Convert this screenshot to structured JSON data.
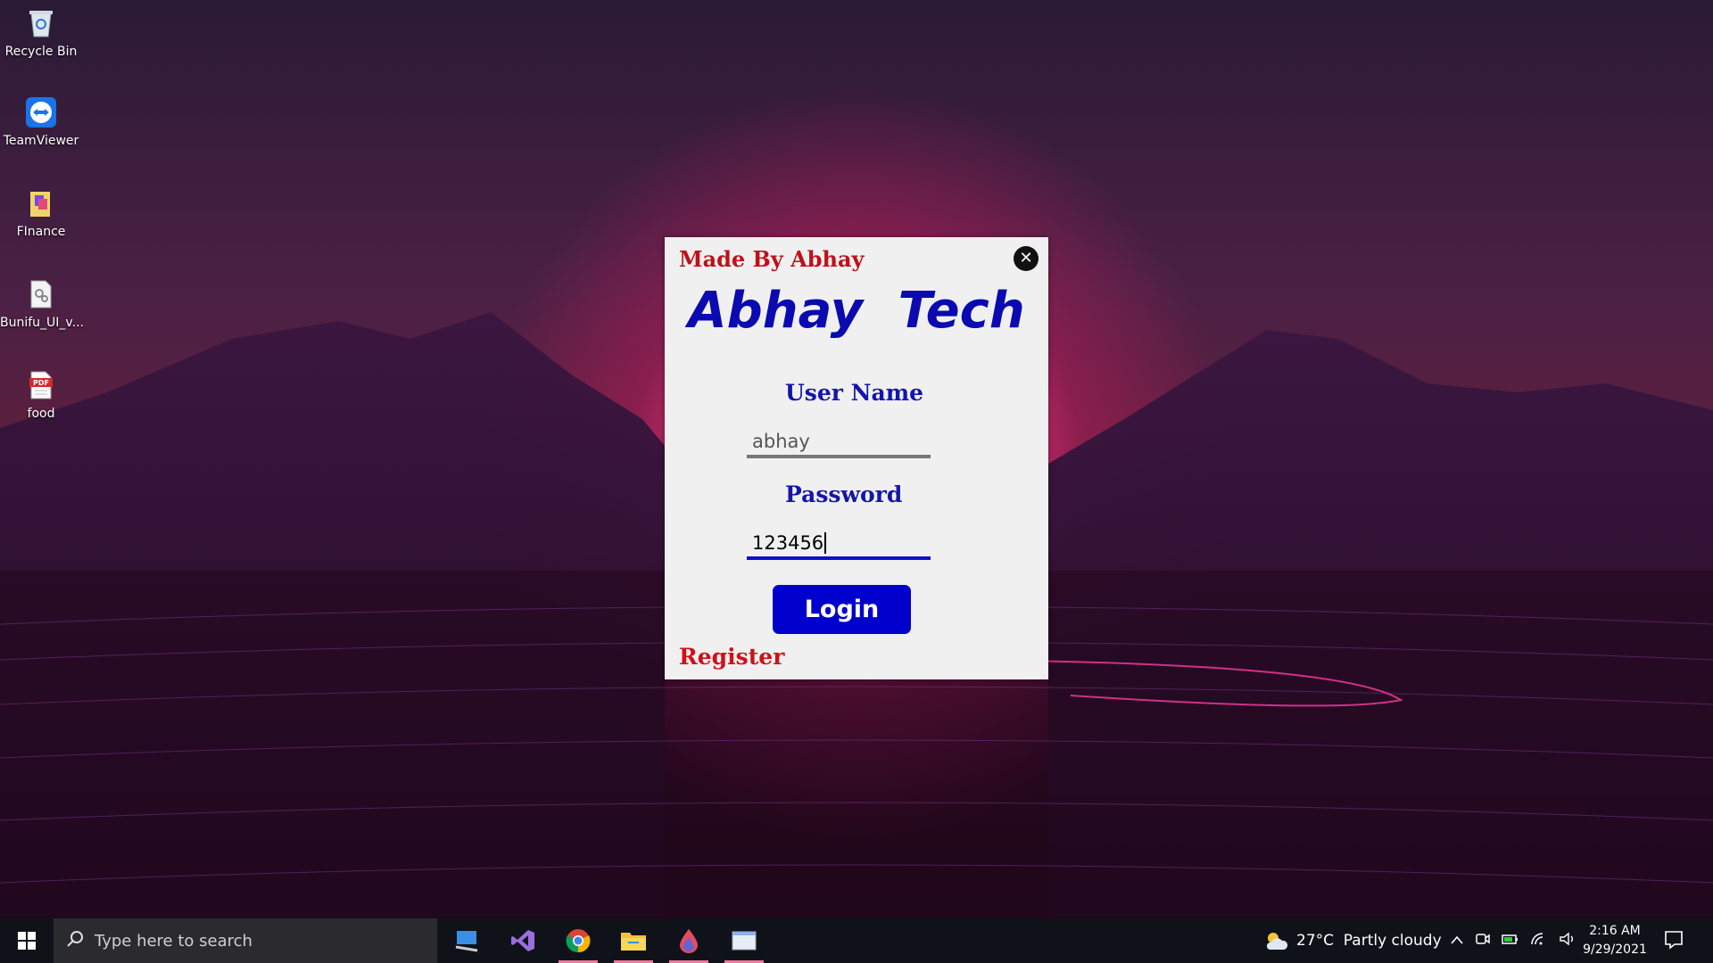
{
  "desktop": {
    "icons": [
      {
        "name": "recycle-bin",
        "label": "Recycle Bin"
      },
      {
        "name": "teamviewer",
        "label": "TeamViewer"
      },
      {
        "name": "finance",
        "label": "FInance"
      },
      {
        "name": "bunifu",
        "label": "Bunifu_UI_v..."
      },
      {
        "name": "food",
        "label": "food"
      }
    ]
  },
  "dialog": {
    "made_by": "Made By Abhay",
    "brand": "Abhay Tech",
    "username_label": "User Name",
    "username_value": "abhay",
    "password_label": "Password",
    "password_value": "123456",
    "login_label": "Login",
    "register_label": "Register",
    "close_symbol": "✕"
  },
  "taskbar": {
    "search_placeholder": "Type here to search",
    "weather": "27°C  Partly cloudy",
    "time": "2:16 AM",
    "date": "9/29/2021"
  },
  "colors": {
    "brand_blue": "#0a0ab0",
    "label_red": "#c0101a",
    "button_blue": "#0000cc"
  }
}
